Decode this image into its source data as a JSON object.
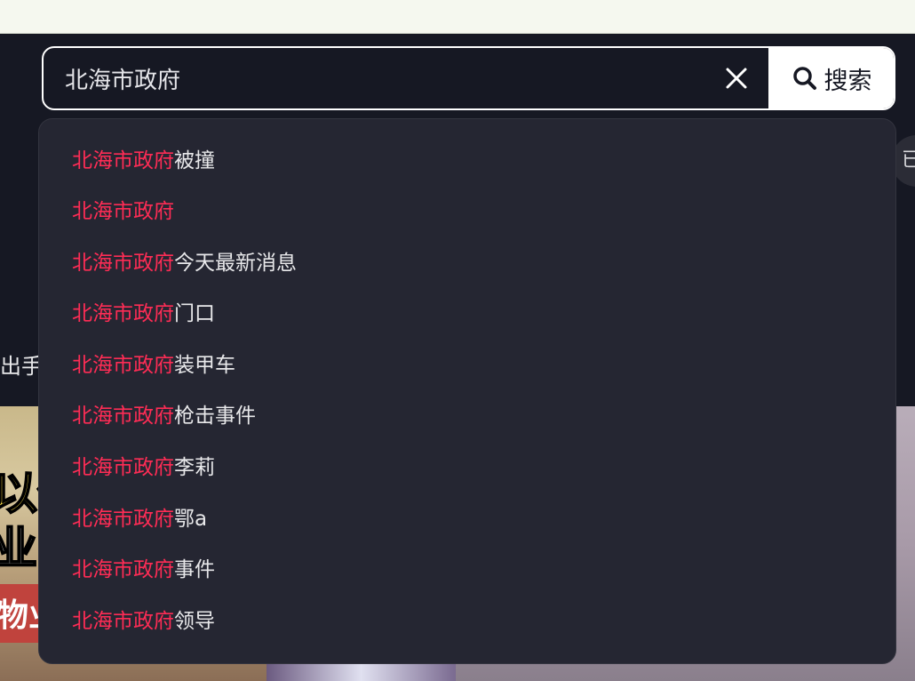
{
  "search": {
    "value": "北海市政府",
    "button_label": "搜索"
  },
  "background": {
    "side_text": "出手",
    "right_chip_text": "已",
    "thumbnail_text_1": "以保",
    "thumbnail_text_2": "业主",
    "thumbnail_text_3": "物业"
  },
  "suggestions": [
    {
      "highlight": "北海市政府",
      "rest": "被撞"
    },
    {
      "highlight": "北海市政府",
      "rest": ""
    },
    {
      "highlight": "北海市政府",
      "rest": "今天最新消息"
    },
    {
      "highlight": "北海市政府",
      "rest": "门口"
    },
    {
      "highlight": "北海市政府",
      "rest": "装甲车"
    },
    {
      "highlight": "北海市政府",
      "rest": "枪击事件"
    },
    {
      "highlight": "北海市政府",
      "rest": "李莉"
    },
    {
      "highlight": "北海市政府",
      "rest": "鄂a"
    },
    {
      "highlight": "北海市政府",
      "rest": "事件"
    },
    {
      "highlight": "北海市政府",
      "rest": "领导"
    }
  ],
  "colors": {
    "highlight": "#fe2c55",
    "page_background": "#161823",
    "dropdown_background": "#252632"
  },
  "icons": {
    "clear": "close-icon",
    "search": "search-icon"
  }
}
